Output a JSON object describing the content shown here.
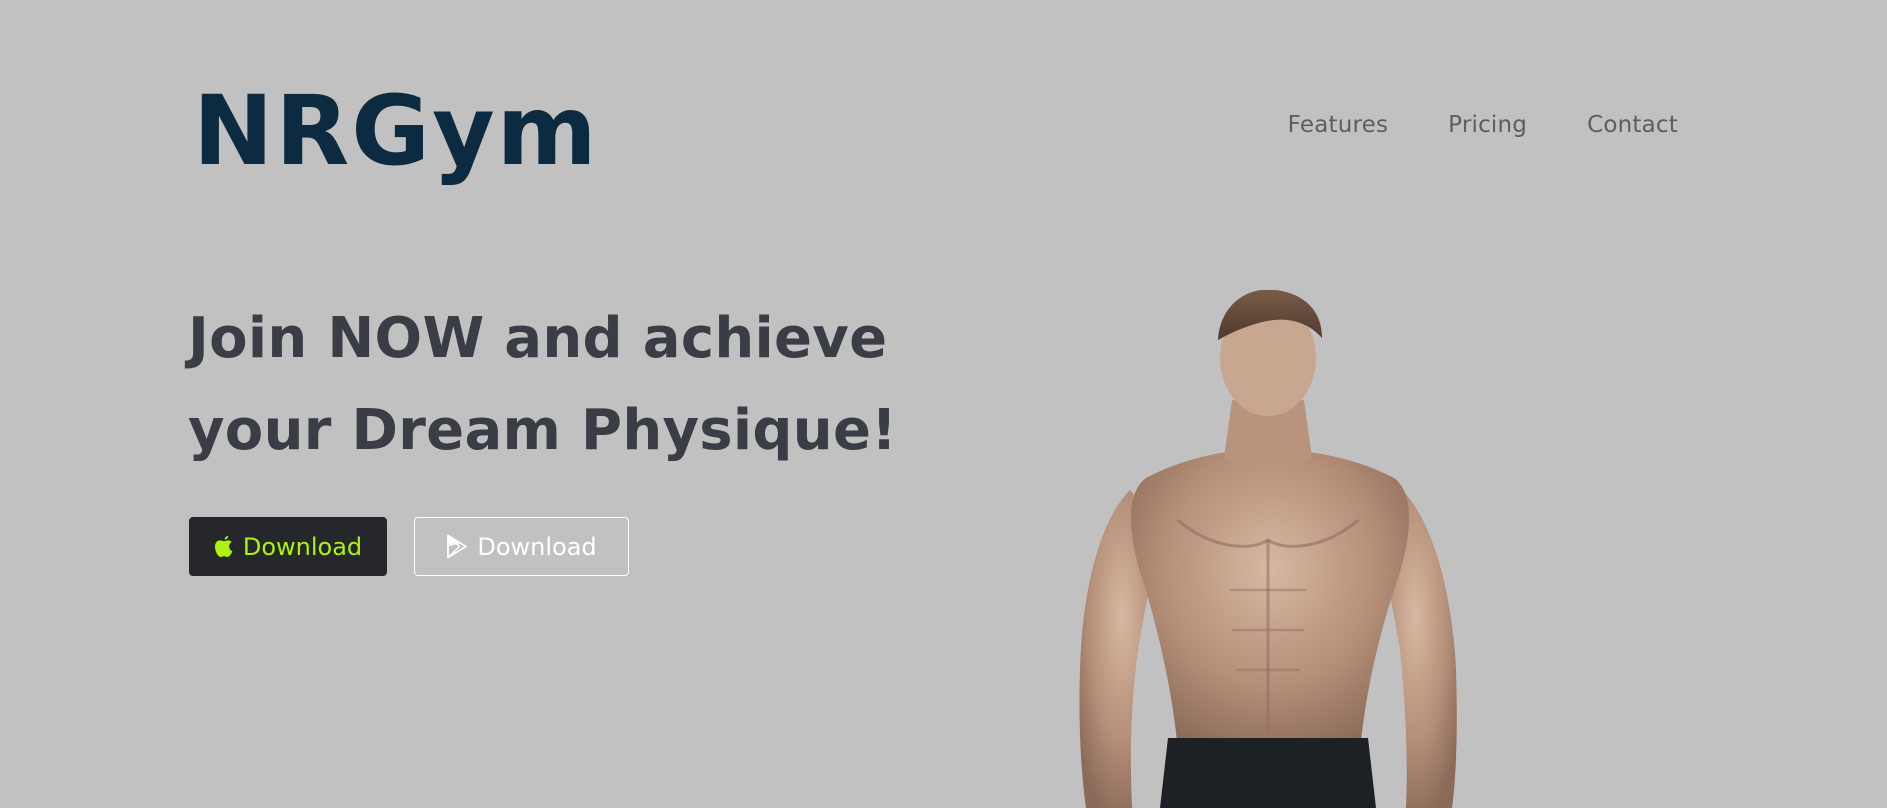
{
  "brand": {
    "logo_text": "NRGym",
    "logo_color": "#0c2a40"
  },
  "nav": {
    "items": [
      {
        "label": "Features"
      },
      {
        "label": "Pricing"
      },
      {
        "label": "Contact"
      }
    ]
  },
  "hero": {
    "headline_line1": "Join NOW and achieve",
    "headline_line2": "your Dream Physique!",
    "image_icon": "athlete-figure"
  },
  "buttons": {
    "apple": {
      "label": "Download",
      "icon": "apple-icon",
      "text_color": "#aef20f",
      "background": "#25272b"
    },
    "play": {
      "label": "Download",
      "icon": "play-store-icon",
      "text_color": "#ffffff"
    }
  },
  "colors": {
    "page_background": "#c1c1c1",
    "headline": "#3a3d45",
    "nav_text": "#5b5e65"
  }
}
